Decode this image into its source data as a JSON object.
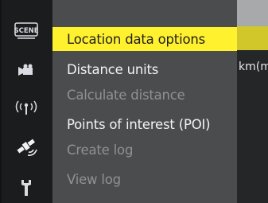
{
  "left_rail": {
    "icons": [
      {
        "name": "scene-mode-icon",
        "label": "SCENE"
      },
      {
        "name": "movie-camera-icon"
      },
      {
        "name": "wireless-signal-icon"
      },
      {
        "name": "satellite-icon"
      },
      {
        "name": "wrench-icon"
      }
    ]
  },
  "menu": {
    "items": [
      {
        "label": "Location data options",
        "state": "selected"
      },
      {
        "label": "Distance units",
        "state": "enabled"
      },
      {
        "label": "Calculate distance",
        "state": "disabled"
      },
      {
        "label": "Points of interest (POI)",
        "state": "enabled"
      },
      {
        "label": "Create log",
        "state": "disabled"
      },
      {
        "label": "View log",
        "state": "disabled"
      }
    ]
  },
  "right_panel": {
    "distance_units_value": "km(m)"
  },
  "colors": {
    "highlight": "#fff12e",
    "menu_bg": "#4a4c4e",
    "disabled_text": "#8f9193"
  }
}
